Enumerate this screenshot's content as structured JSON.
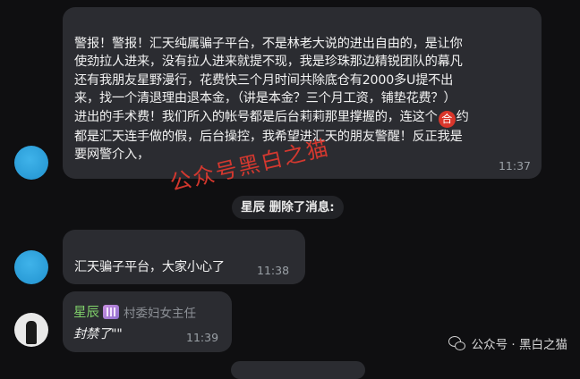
{
  "messages": [
    {
      "text_lines": [
        "警报！警报！汇天纯属骗子平台，不是林老大说的进出自由的，是让你",
        "使劲拉人进来，没有拉人进来就提不现，我是珍珠那边精锐团队的幕凡",
        "还有我朋友星野漫行，花费快三个月时间共除底仓有2000多U提不出",
        "来，找一个清退理由退本金，（讲是本金？三个月工资，铺垫花费？）",
        "进出的手术费！我们所入的帐号都是后台莉莉那里撑握的，连这个",
        "约",
        "都是汇天连手做的假，后台操控，我希望进汇天的朋友警醒！反正我是",
        "要网警介入，"
      ],
      "badge": "合",
      "time": "11:37"
    },
    {
      "text": "汇天骗子平台，大家小心了",
      "time": "11:38"
    },
    {
      "sender": "星辰",
      "title_badge": "村委妇女主任",
      "text": "封禁了\"\"",
      "time": "11:39"
    }
  ],
  "system_message": {
    "user": "星辰",
    "action": " 删除了消息:"
  },
  "watermark": "公众号黑白之猫",
  "footer": {
    "text": "公众号 · 黑白之猫"
  },
  "colors": {
    "bubble": "#2b2c31",
    "background": "#0f0f11",
    "sender_name": "#7fcf6a",
    "watermark": "#e23a2f"
  }
}
